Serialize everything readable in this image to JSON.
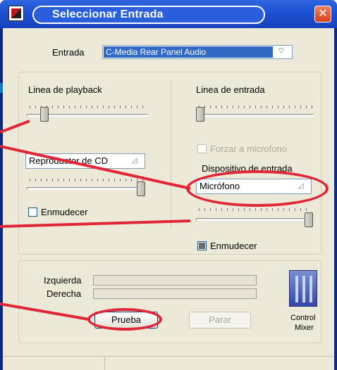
{
  "window": {
    "title": "Seleccionar Entrada",
    "close_glyph": "✕"
  },
  "entrada": {
    "label": "Entrada",
    "selected": "C-Media Rear Panel Audio"
  },
  "playback": {
    "label": "Linea de playback",
    "volume_percent": 12,
    "source": "Reproductor de CD",
    "source_volume_percent": 100,
    "mute_label": "Enmudecer",
    "mute_checked": false
  },
  "input": {
    "label": "Linea de entrada",
    "volume_percent": 0,
    "force_mic_label": "Forzar a microfono",
    "force_mic_checked": false,
    "device_label": "Dispositivo de entrada",
    "device": "Micrófono",
    "device_volume_percent": 100,
    "mute_label": "Enmudecer",
    "mute_checked": true
  },
  "test": {
    "left_label": "Izquierda",
    "right_label": "Derecha",
    "left_level": 0,
    "right_level": 0,
    "test_button": "Prueba",
    "stop_button": "Parar"
  },
  "mixer": {
    "label_line1": "Control",
    "label_line2": "Mixer"
  },
  "colors": {
    "annotation": "#e12737",
    "titlebar": "#1e50d2",
    "selection": "#316ac5"
  }
}
